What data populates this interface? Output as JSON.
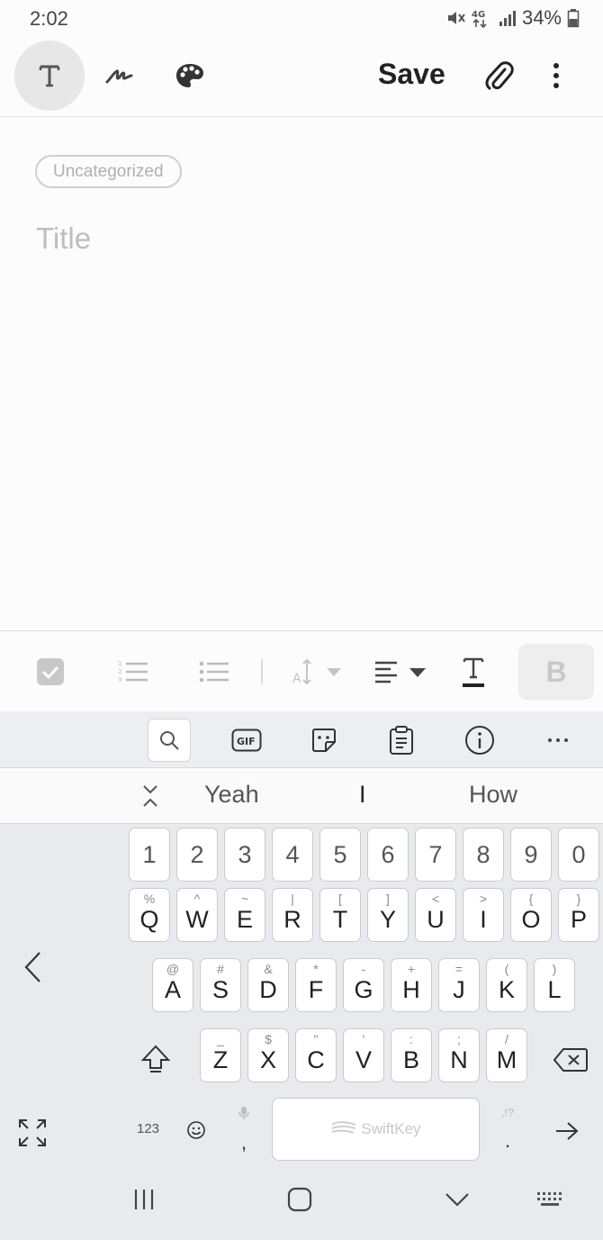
{
  "status_bar": {
    "time": "2:02",
    "battery": "34%"
  },
  "toolbar": {
    "save_label": "Save"
  },
  "note": {
    "category": "Uncategorized",
    "title_placeholder": "Title"
  },
  "format_bar": {
    "bold_label": "B"
  },
  "suggestions": [
    "Yeah",
    "I",
    "How"
  ],
  "keyboard": {
    "number_row": [
      "1",
      "2",
      "3",
      "4",
      "5",
      "6",
      "7",
      "8",
      "9",
      "0"
    ],
    "row1": [
      {
        "key": "Q",
        "alt": "%"
      },
      {
        "key": "W",
        "alt": "^"
      },
      {
        "key": "E",
        "alt": "~"
      },
      {
        "key": "R",
        "alt": "|"
      },
      {
        "key": "T",
        "alt": "["
      },
      {
        "key": "Y",
        "alt": "]"
      },
      {
        "key": "U",
        "alt": "<"
      },
      {
        "key": "I",
        "alt": ">"
      },
      {
        "key": "O",
        "alt": "{"
      },
      {
        "key": "P",
        "alt": "}"
      }
    ],
    "row2": [
      {
        "key": "A",
        "alt": "@"
      },
      {
        "key": "S",
        "alt": "#"
      },
      {
        "key": "D",
        "alt": "&"
      },
      {
        "key": "F",
        "alt": "*"
      },
      {
        "key": "G",
        "alt": "-"
      },
      {
        "key": "H",
        "alt": "+"
      },
      {
        "key": "J",
        "alt": "="
      },
      {
        "key": "K",
        "alt": "("
      },
      {
        "key": "L",
        "alt": ")"
      }
    ],
    "row3": [
      {
        "key": "Z",
        "alt": "_"
      },
      {
        "key": "X",
        "alt": "$"
      },
      {
        "key": "C",
        "alt": "\""
      },
      {
        "key": "V",
        "alt": "'"
      },
      {
        "key": "B",
        "alt": ":"
      },
      {
        "key": "N",
        "alt": ";"
      },
      {
        "key": "M",
        "alt": "/"
      }
    ],
    "symbols_label": "123",
    "comma": ",",
    "period": ".",
    "period_alt": ",!?",
    "space_brand": "SwiftKey"
  }
}
